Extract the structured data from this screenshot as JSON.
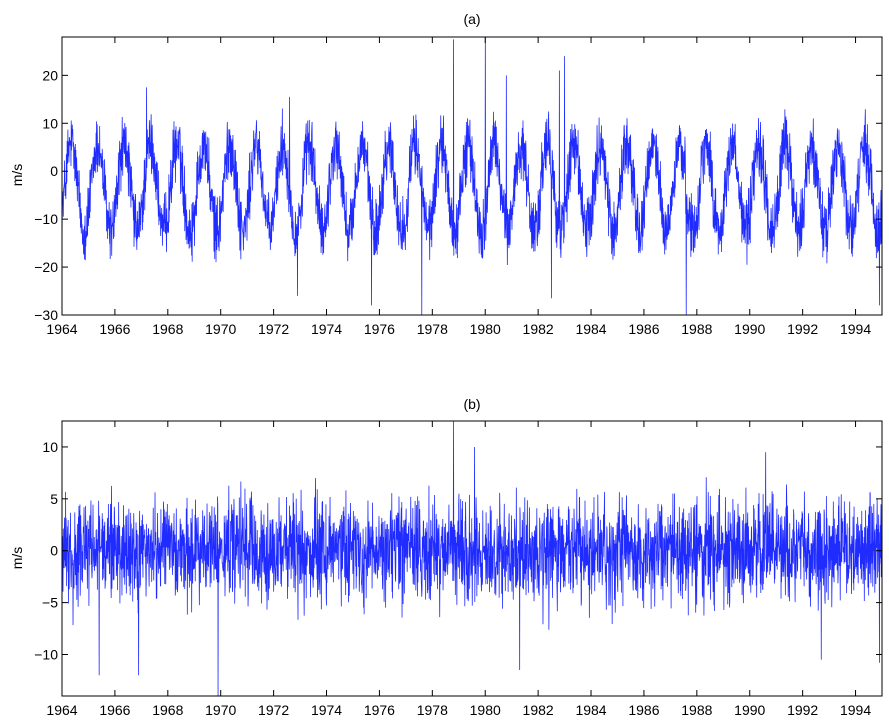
{
  "chart_data": [
    {
      "type": "line",
      "title": "(a)",
      "xlabel": "",
      "ylabel": "m/s",
      "xlim": [
        1964,
        1995
      ],
      "ylim": [
        -30,
        28
      ],
      "xticks": [
        "1964",
        "1966",
        "1968",
        "1970",
        "1972",
        "1974",
        "1976",
        "1978",
        "1980",
        "1982",
        "1984",
        "1986",
        "1988",
        "1990",
        "1992",
        "1994"
      ],
      "yticks": [
        "20",
        "10",
        "0",
        "−10",
        "−20",
        "−30"
      ],
      "grid": false,
      "line_color": "#1f2bff",
      "series_description_kind": "seasonal",
      "annual_amplitude": 9,
      "noise_amplitude": 5,
      "notable_peaks": [
        {
          "x": 1978.8,
          "y": 27.5
        },
        {
          "x": 1980.0,
          "y": 28.0
        },
        {
          "x": 1983.0,
          "y": 24.0
        },
        {
          "x": 1967.2,
          "y": 17.5
        },
        {
          "x": 1972.6,
          "y": 15.5
        },
        {
          "x": 1980.8,
          "y": 20.0
        },
        {
          "x": 1982.8,
          "y": 21.0
        }
      ],
      "notable_troughs": [
        {
          "x": 1977.6,
          "y": -30.0
        },
        {
          "x": 1987.6,
          "y": -30.0
        },
        {
          "x": 1975.7,
          "y": -28.0
        },
        {
          "x": 1982.5,
          "y": -26.5
        },
        {
          "x": 1972.9,
          "y": -26.0
        },
        {
          "x": 1994.9,
          "y": -28.0
        }
      ]
    },
    {
      "type": "line",
      "title": "(b)",
      "xlabel": "",
      "ylabel": "m/s",
      "xlim": [
        1964,
        1995
      ],
      "ylim": [
        -14,
        12.5
      ],
      "xticks": [
        "1964",
        "1966",
        "1968",
        "1970",
        "1972",
        "1974",
        "1976",
        "1978",
        "1980",
        "1982",
        "1984",
        "1986",
        "1988",
        "1990",
        "1992",
        "1994"
      ],
      "yticks": [
        "10",
        "5",
        "0",
        "−5",
        "−10"
      ],
      "grid": false,
      "line_color": "#1f2bff",
      "series_description_kind": "noise",
      "noise_amplitude": 3,
      "notable_peaks": [
        {
          "x": 1978.8,
          "y": 12.5
        },
        {
          "x": 1965.4,
          "y": 10.5
        },
        {
          "x": 1979.6,
          "y": 10.0
        },
        {
          "x": 1990.6,
          "y": 9.5
        }
      ],
      "notable_troughs": [
        {
          "x": 1969.9,
          "y": -14.0
        },
        {
          "x": 1965.4,
          "y": -12.0
        },
        {
          "x": 1966.9,
          "y": -12.0
        },
        {
          "x": 1981.3,
          "y": -11.5
        },
        {
          "x": 1992.7,
          "y": -10.5
        },
        {
          "x": 1994.9,
          "y": -10.8
        }
      ]
    }
  ]
}
